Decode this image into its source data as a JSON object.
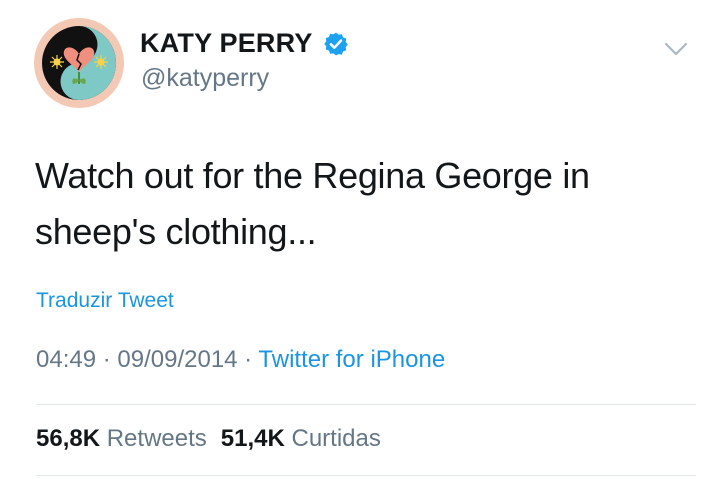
{
  "user": {
    "display_name": "KATY PERRY",
    "handle": "@katyperry",
    "verified_icon": "verified-badge-icon",
    "verified_color": "#1da1f2"
  },
  "menu_icon": "chevron-down-icon",
  "tweet": {
    "text_line1": "Watch out for the Regina George in",
    "text_line2": "sheep's clothing...",
    "translate_label": "Traduzir Tweet",
    "time": "04:49",
    "separator": " · ",
    "date": "09/09/2014",
    "source": "Twitter for iPhone"
  },
  "stats": {
    "retweets_count": "56,8K",
    "retweets_label": "Retweets",
    "likes_count": "51,4K",
    "likes_label": "Curtidas"
  },
  "colors": {
    "link": "#1b95e0",
    "secondary_text": "#657786",
    "primary_text": "#14171a"
  }
}
